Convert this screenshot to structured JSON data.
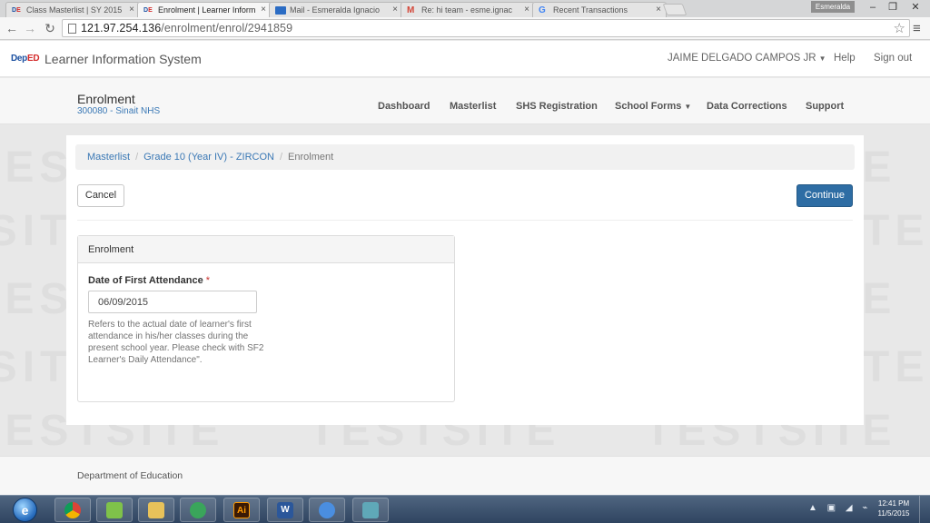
{
  "browser": {
    "tabs": [
      {
        "title": "Class Masterlist | SY 2015",
        "favicon": "deped-favicon"
      },
      {
        "title": "Enrolment | Learner Inform",
        "favicon": "deped-favicon"
      },
      {
        "title": "Mail - Esmeralda Ignacio",
        "favicon": "mail-favicon"
      },
      {
        "title": "Re: hi team - esme.ignac",
        "favicon": "gmail-favicon"
      },
      {
        "title": "Recent Transactions",
        "favicon": "google-favicon"
      }
    ],
    "active_tab_index": 1,
    "profile_name": "Esmeralda",
    "url_host": "121.97.254.136",
    "url_path": "/enrolment/enrol/2941859"
  },
  "app": {
    "logo_part1": "Dep",
    "logo_part2": "ED",
    "title": "Learner Information System",
    "user_name": "JAIME DELGADO CAMPOS JR",
    "help_label": "Help",
    "signout_label": "Sign out"
  },
  "subnav": {
    "section_title": "Enrolment",
    "school": "300080 - Sinait NHS",
    "items": [
      {
        "label": "Dashboard"
      },
      {
        "label": "Masterlist"
      },
      {
        "label": "SHS Registration"
      },
      {
        "label": "School Forms",
        "has_caret": true
      },
      {
        "label": "Data Corrections"
      },
      {
        "label": "Support"
      }
    ]
  },
  "breadcrumb": {
    "items": [
      "Masterlist",
      "Grade 10 (Year IV) - ZIRCON"
    ],
    "current": "Enrolment"
  },
  "actions": {
    "cancel_label": "Cancel",
    "continue_label": "Continue"
  },
  "form": {
    "panel_title": "Enrolment",
    "date_label": "Date of First Attendance",
    "required_mark": "*",
    "date_value": "06/09/2015",
    "help_text": "Refers to the actual date of learner's first attendance in his/her classes during the present school year. Please check with SF2 Learner's Daily Attendance\"."
  },
  "watermark_text": "TESTSITE",
  "footer": {
    "text": "Department of Education"
  },
  "taskbar": {
    "apps": [
      "ie-icon",
      "chrome-icon",
      "file-explorer-icon",
      "folder-icon",
      "green-app-icon",
      "illustrator-icon",
      "word-icon",
      "blue-app-icon",
      "teal-app-icon"
    ],
    "illustrator_label": "Ai",
    "word_label": "W",
    "time": "12:41 PM",
    "date": "11/5/2015"
  },
  "colors": {
    "primary": "#2e6da4",
    "link": "#3a78b5",
    "required": "#c9302c"
  }
}
